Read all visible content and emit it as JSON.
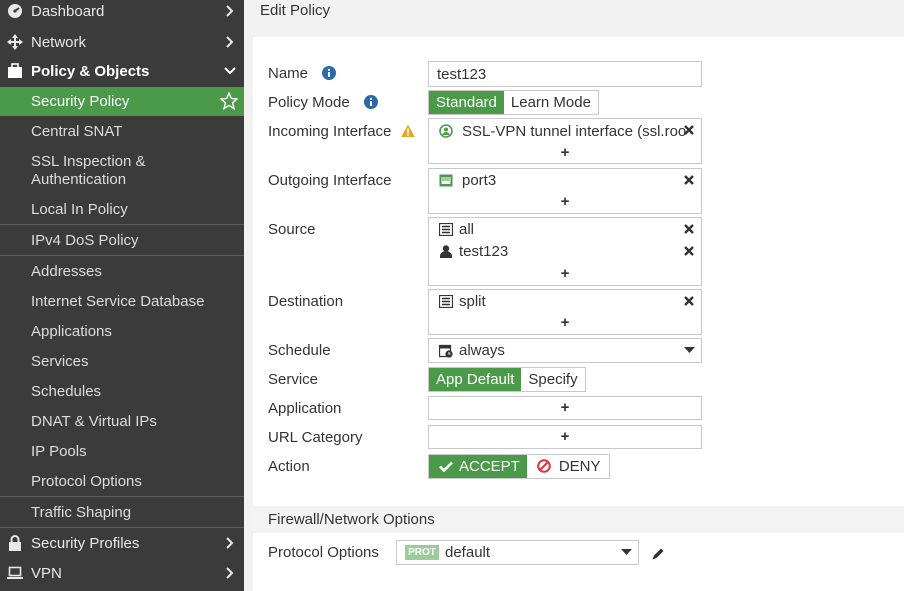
{
  "sidebar": {
    "top": [
      {
        "label": "Dashboard",
        "icon": "dashboard-icon"
      },
      {
        "label": "Network",
        "icon": "network-icon"
      },
      {
        "label": "Policy & Objects",
        "icon": "briefcase-icon"
      }
    ],
    "sub": [
      "Security Policy",
      "Central SNAT",
      "SSL Inspection & Authentication",
      "Local In Policy",
      "IPv4 DoS Policy",
      "Addresses",
      "Internet Service Database",
      "Applications",
      "Services",
      "Schedules",
      "DNAT & Virtual IPs",
      "IP Pools",
      "Protocol Options",
      "Traffic Shaping"
    ],
    "bottom": [
      {
        "label": "Security Profiles",
        "icon": "lock-icon"
      },
      {
        "label": "VPN",
        "icon": "laptop-icon"
      }
    ],
    "accent": "#4a9a4a"
  },
  "header": {
    "title": "Edit Policy"
  },
  "form": {
    "name_label": "Name",
    "name_value": "test123",
    "mode_label": "Policy Mode",
    "mode_standard": "Standard",
    "mode_learn": "Learn Mode",
    "incoming_label": "Incoming Interface",
    "incoming_value": "SSL-VPN tunnel interface (ssl.roo",
    "outgoing_label": "Outgoing Interface",
    "outgoing_value": "port3",
    "source_label": "Source",
    "source_values": [
      "all",
      "test123"
    ],
    "destination_label": "Destination",
    "destination_value": "split",
    "schedule_label": "Schedule",
    "schedule_value": "always",
    "service_label": "Service",
    "service_app_default": "App Default",
    "service_specify": "Specify",
    "application_label": "Application",
    "url_label": "URL Category",
    "action_label": "Action",
    "action_accept": "ACCEPT",
    "action_deny": "DENY",
    "plus": "+"
  },
  "firewall": {
    "section_title": "Firewall/Network Options",
    "protocol_label": "Protocol Options",
    "protocol_badge": "PROT",
    "protocol_value": "default"
  }
}
